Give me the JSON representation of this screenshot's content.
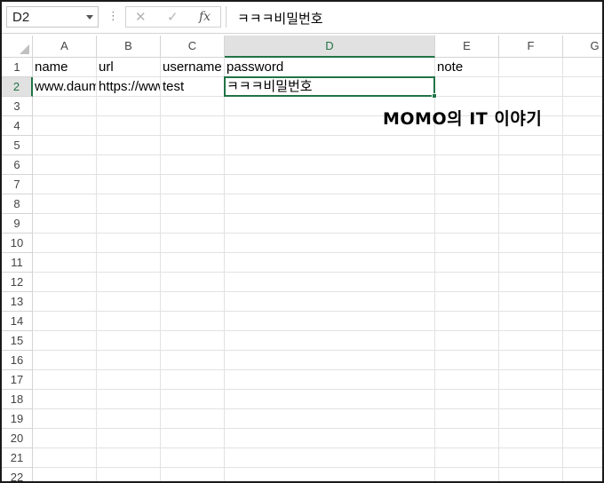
{
  "formula_bar": {
    "name_box": "D2",
    "more_glyph": "⋮",
    "cancel_glyph": "✕",
    "enter_glyph": "✓",
    "fx_label": "fx",
    "formula": "ㅋㅋㅋ비밀번호"
  },
  "columns": [
    "A",
    "B",
    "C",
    "D",
    "E",
    "F",
    "G"
  ],
  "rows": [
    "1",
    "2",
    "3",
    "4",
    "5",
    "6",
    "7",
    "8",
    "9",
    "10",
    "11",
    "12",
    "13",
    "14",
    "15",
    "16",
    "17",
    "18",
    "19",
    "20",
    "21",
    "22"
  ],
  "cells": {
    "A1": "name",
    "B1": "url",
    "C1": "username",
    "D1": "password",
    "E1": "note",
    "A2": "www.daum.net",
    "B2": "https://www.daum.net",
    "C2": "test",
    "D2": "ㅋㅋㅋ비밀번호"
  },
  "selection": {
    "cell": "D2",
    "column": "D",
    "row": "2",
    "accent": "#217346"
  },
  "watermark": "MOMO의 IT 이야기"
}
